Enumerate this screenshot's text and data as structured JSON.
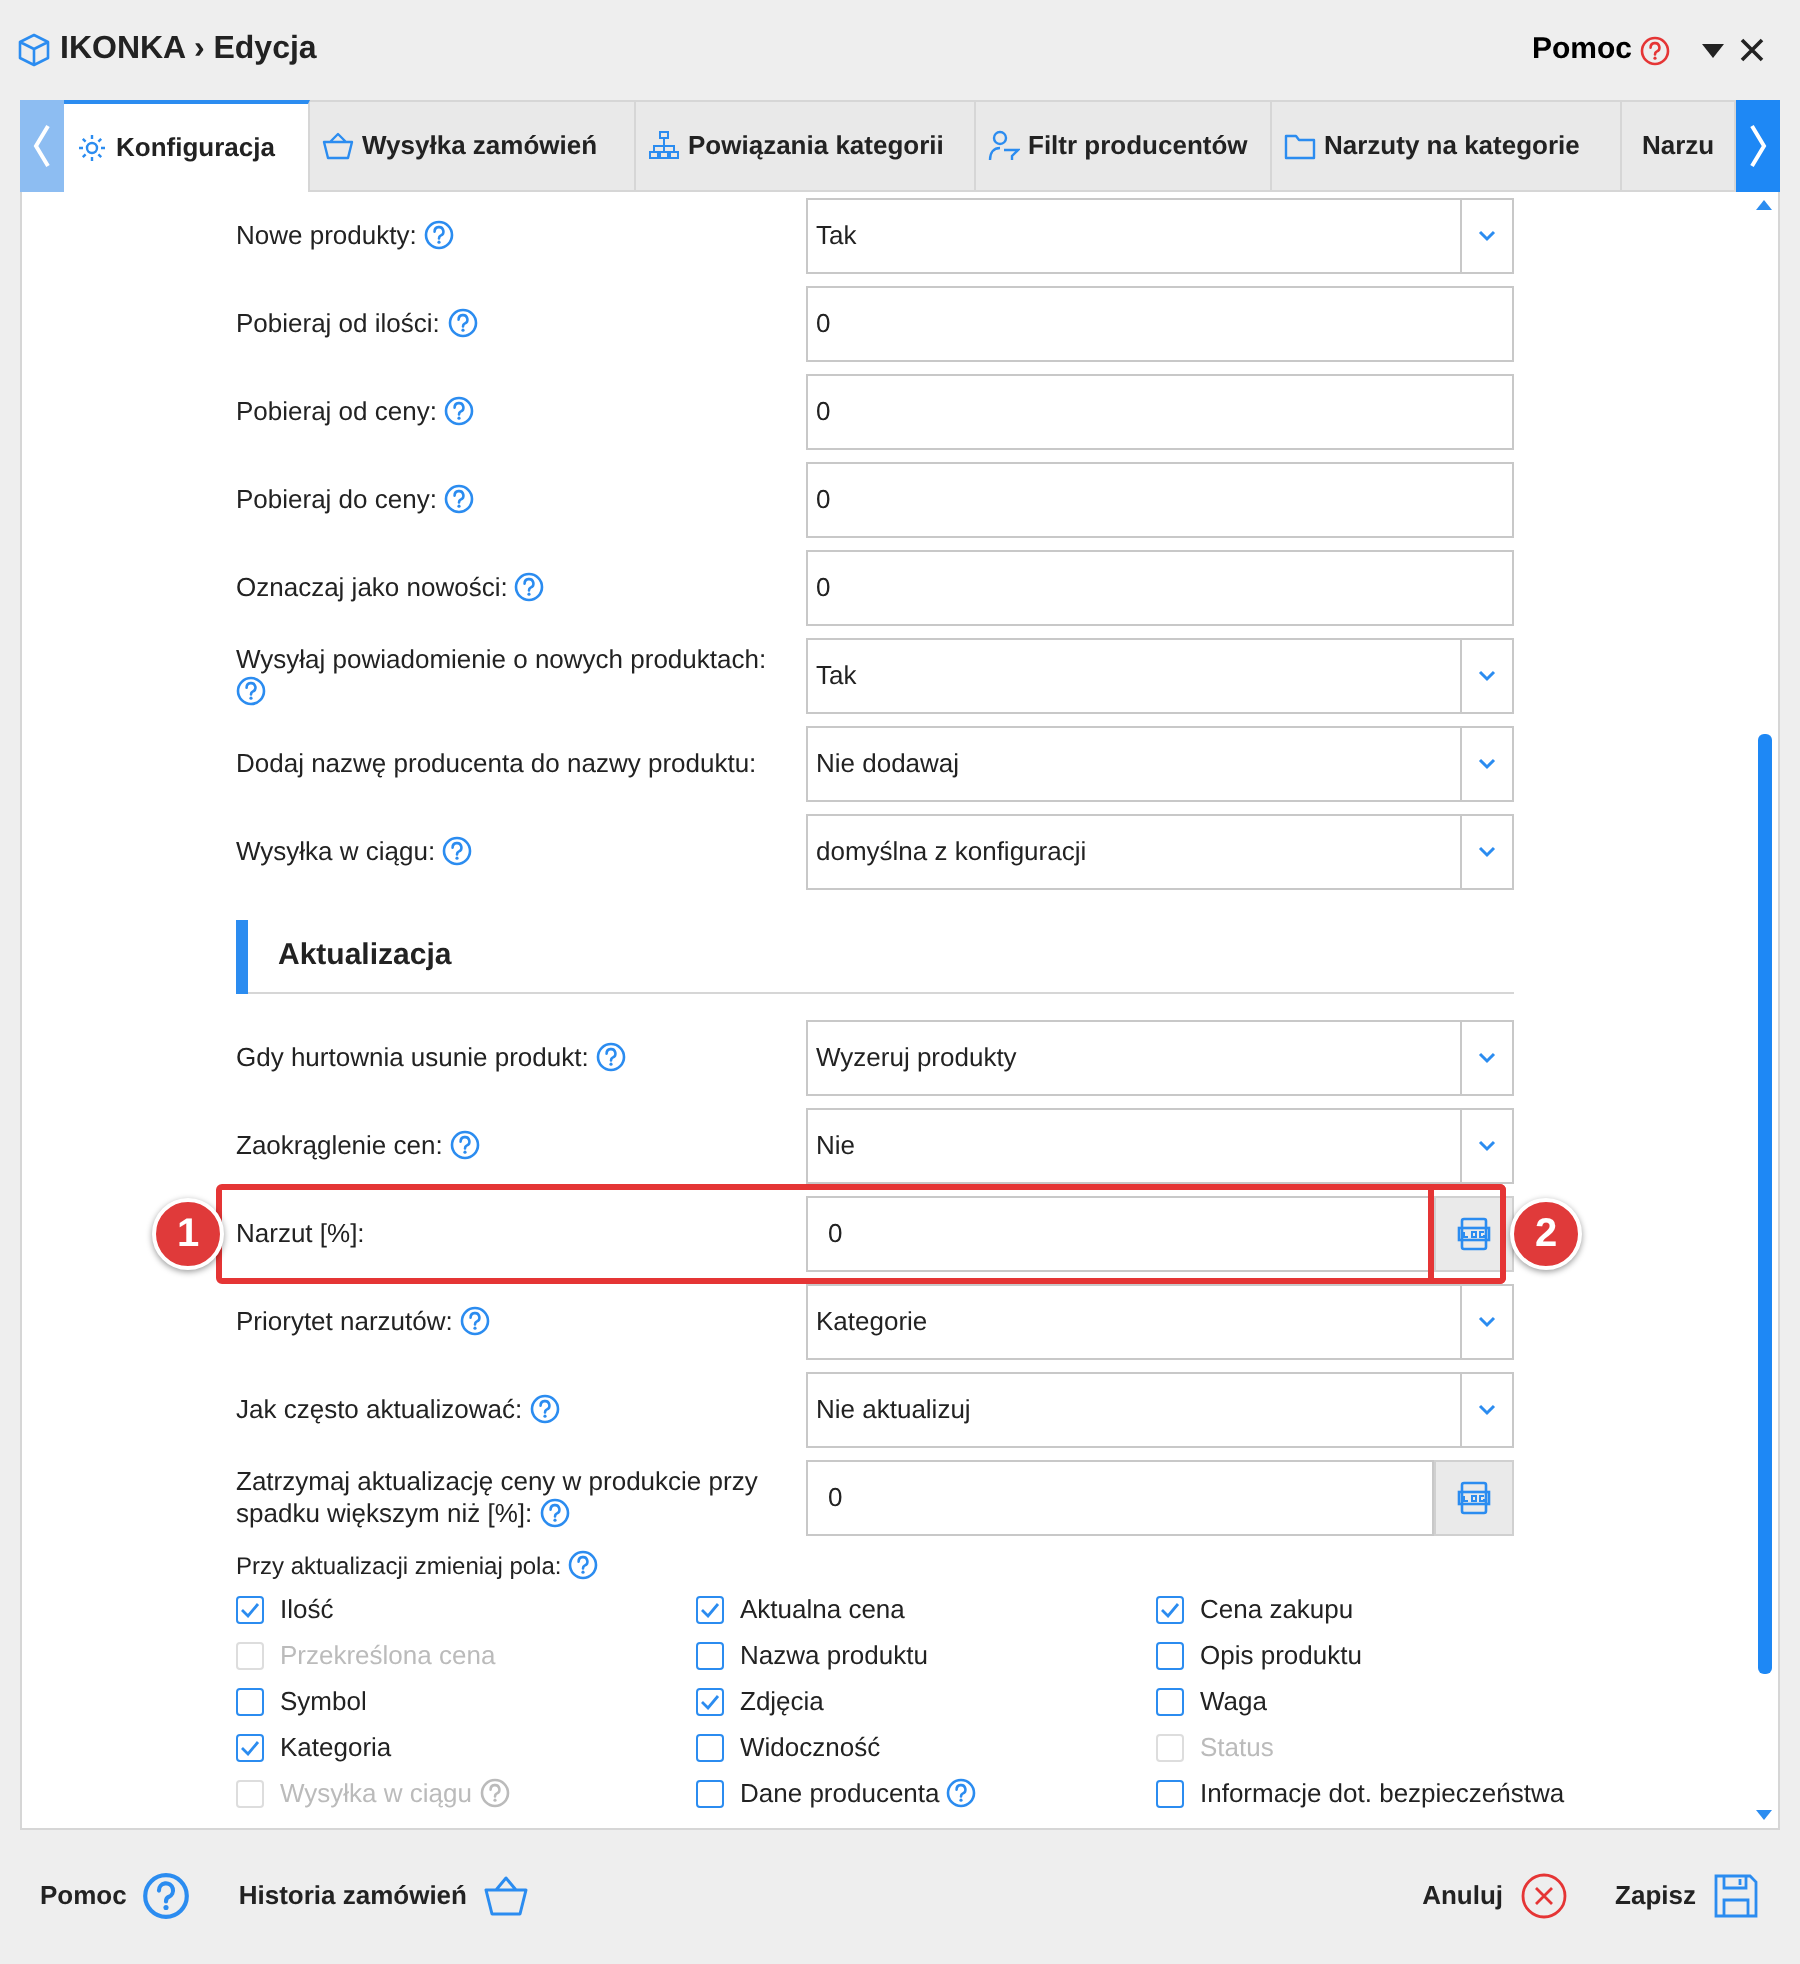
{
  "window": {
    "title": "IKONKA › Edycja",
    "help": "Pomoc"
  },
  "tabs": [
    {
      "label": "Konfiguracja",
      "selected": true
    },
    {
      "label": "Wysyłka zamówień",
      "selected": false
    },
    {
      "label": "Powiązania kategorii",
      "selected": false
    },
    {
      "label": "Filtr producentów",
      "selected": false
    },
    {
      "label": "Narzuty na kategorie",
      "selected": false
    },
    {
      "label": "Narzu",
      "selected": false
    }
  ],
  "settings": [
    {
      "label": "Nowe produkty:",
      "help": true,
      "kind": "select",
      "value": "Tak"
    },
    {
      "label": "Pobieraj od ilości:",
      "help": true,
      "kind": "input",
      "value": "0"
    },
    {
      "label": "Pobieraj od ceny:",
      "help": true,
      "kind": "input",
      "value": "0"
    },
    {
      "label": "Pobieraj do ceny:",
      "help": true,
      "kind": "input",
      "value": "0"
    },
    {
      "label": "Oznaczaj jako nowości:",
      "help": true,
      "kind": "input",
      "value": "0"
    },
    {
      "label": "Wysyłaj powiadomienie o nowych produktach:",
      "help": true,
      "kind": "select",
      "value": "Tak"
    },
    {
      "label": "Dodaj nazwę producenta do nazwy produktu:",
      "help": false,
      "kind": "select",
      "value": "Nie dodawaj"
    },
    {
      "label": "Wysyłka w ciągu:",
      "help": true,
      "kind": "select",
      "value": "domyślna z konfiguracji"
    }
  ],
  "section": {
    "title": "Aktualizacja"
  },
  "update_settings": [
    {
      "label": "Gdy hurtownia usunie produkt:",
      "help": true,
      "kind": "select",
      "value": "Wyzeruj produkty"
    },
    {
      "label": "Zaokrąglenie cen:",
      "help": true,
      "kind": "select",
      "value": "Nie"
    },
    {
      "label": "Narzut [%]:",
      "help": false,
      "kind": "log",
      "value": "0",
      "callouts": [
        "1",
        "2"
      ]
    },
    {
      "label": "Priorytet narzutów:",
      "help": true,
      "kind": "select",
      "value": "Kategorie"
    },
    {
      "label": "Jak często aktualizować:",
      "help": true,
      "kind": "select",
      "value": "Nie aktualizuj"
    },
    {
      "label": "Zatrzymaj aktualizację ceny w produkcie przy spadku większym niż [%]:",
      "help": true,
      "kind": "log",
      "value": "0"
    }
  ],
  "fields": {
    "label": "Przy aktualizacji zmieniaj pola:",
    "help": true,
    "items": [
      {
        "label": "Ilość",
        "checked": true,
        "disabled": false,
        "help": false
      },
      {
        "label": "Aktualna cena",
        "checked": true,
        "disabled": false,
        "help": false
      },
      {
        "label": "Cena zakupu",
        "checked": true,
        "disabled": false,
        "help": false
      },
      {
        "label": "Przekreślona cena",
        "checked": false,
        "disabled": true,
        "help": false
      },
      {
        "label": "Nazwa produktu",
        "checked": false,
        "disabled": false,
        "help": false
      },
      {
        "label": "Opis produktu",
        "checked": false,
        "disabled": false,
        "help": false
      },
      {
        "label": "Symbol",
        "checked": false,
        "disabled": false,
        "help": false
      },
      {
        "label": "Zdjęcia",
        "checked": true,
        "disabled": false,
        "help": false
      },
      {
        "label": "Waga",
        "checked": false,
        "disabled": false,
        "help": false
      },
      {
        "label": "Kategoria",
        "checked": true,
        "disabled": false,
        "help": false
      },
      {
        "label": "Widoczność",
        "checked": false,
        "disabled": false,
        "help": false
      },
      {
        "label": "Status",
        "checked": false,
        "disabled": true,
        "help": false
      },
      {
        "label": "Wysyłka w ciągu",
        "checked": false,
        "disabled": true,
        "help": true
      },
      {
        "label": "Dane producenta",
        "checked": false,
        "disabled": false,
        "help": true
      },
      {
        "label": "Informacje dot. bezpieczeństwa",
        "checked": false,
        "disabled": false,
        "help": false
      }
    ]
  },
  "footer": {
    "left": [
      "Pomoc",
      "Historia zamówień"
    ],
    "right": [
      "Anuluj",
      "Zapisz"
    ]
  }
}
